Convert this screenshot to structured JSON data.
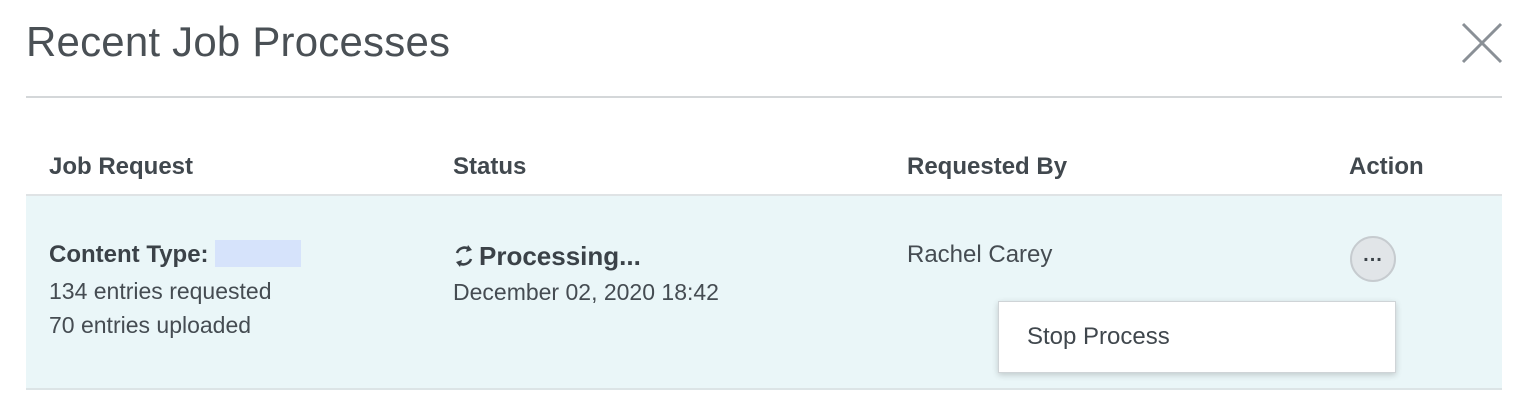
{
  "dialog": {
    "title": "Recent Job Processes",
    "close_icon": "close-icon"
  },
  "table": {
    "headers": {
      "job_request": "Job Request",
      "status": "Status",
      "requested_by": "Requested By",
      "action": "Action"
    },
    "rows": [
      {
        "content_type_label": "Content Type:",
        "entries_requested": "134 entries requested",
        "entries_uploaded": "70 entries uploaded",
        "status_icon": "sync-icon",
        "status": "Processing...",
        "status_date": "December 02, 2020 18:42",
        "requested_by": "Rachel Carey",
        "action_label": "...",
        "action_icon": "more-options-icon"
      }
    ]
  },
  "action_menu": {
    "items": [
      "Stop Process"
    ]
  },
  "colors": {
    "row_background": "#eaf6f8",
    "redaction": "#d6e3fb",
    "text": "#40474d"
  }
}
